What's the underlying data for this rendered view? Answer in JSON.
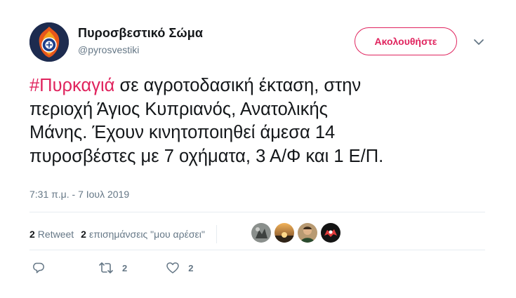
{
  "account": {
    "display_name": "Πυροσβεστικό Σώμα",
    "handle": "@pyrosvestiki",
    "avatar_icon": "fire-service-emblem-icon"
  },
  "follow_button": {
    "label": "Ακολουθήστε",
    "color": "#e0245e"
  },
  "tweet": {
    "hashtag": "#Πυρκαγιά",
    "line1_rest": " σε αγροτοδασική έκταση, στην",
    "line2": "περιοχή Άγιος Κυπριανός, Ανατολικής",
    "line3": "Μάνης. Έχουν κινητοποιηθεί άμεσα 14",
    "line4": "πυροσβέστες με 7 οχήματα, 3 Α/Φ και 1 Ε/Π."
  },
  "timestamp": "7:31 π.μ. - 7 Ιουλ 2019",
  "stats": {
    "retweets_count": "2",
    "retweets_label": "Retweet",
    "likes_count": "2",
    "likes_label": "επισημάνσεις \"μου αρέσει\""
  },
  "liker_avatars": [
    "liker-avatar-1",
    "liker-avatar-2",
    "liker-avatar-3",
    "liker-avatar-4"
  ],
  "actions": {
    "reply_icon": "reply-icon",
    "retweet_icon": "retweet-icon",
    "retweet_count": "2",
    "like_icon": "heart-icon",
    "like_count": "2"
  },
  "colors": {
    "accent": "#e0245e",
    "muted": "#657786",
    "text": "#14171a",
    "divider": "#e6ecf0"
  }
}
